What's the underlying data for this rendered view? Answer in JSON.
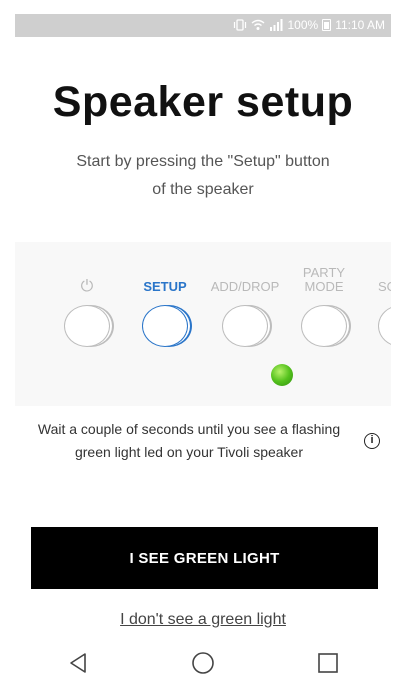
{
  "status_bar": {
    "battery_percent": "100%",
    "time": "11:10 AM",
    "icons": [
      "vibrate-icon",
      "wifi-icon",
      "signal-icon",
      "battery-icon"
    ]
  },
  "title": "Speaker setup",
  "subtitle": "Start by pressing the \"Setup\" button of the speaker",
  "speaker_buttons": [
    {
      "label": "⏻",
      "icon": "power-icon",
      "active": false
    },
    {
      "label": "SETUP",
      "active": true
    },
    {
      "label": "ADD/DROP",
      "active": false
    },
    {
      "label": "PARTY MODE",
      "active": false
    },
    {
      "label": "SO",
      "active": false
    }
  ],
  "led": {
    "color": "#55c21d",
    "state": "green-light"
  },
  "instruction": "Wait a couple of seconds until you see a flashing green light led on your Tivoli speaker",
  "primary_button": "I SEE GREEN LIGHT",
  "secondary_link": "I don't see a green light",
  "colors": {
    "accent": "#2a75c9",
    "button_bg": "#000000",
    "status_bar_bg": "#cfcfcf",
    "led_green": "#55c21d"
  },
  "nav": [
    "back-icon",
    "home-icon",
    "recents-icon"
  ]
}
